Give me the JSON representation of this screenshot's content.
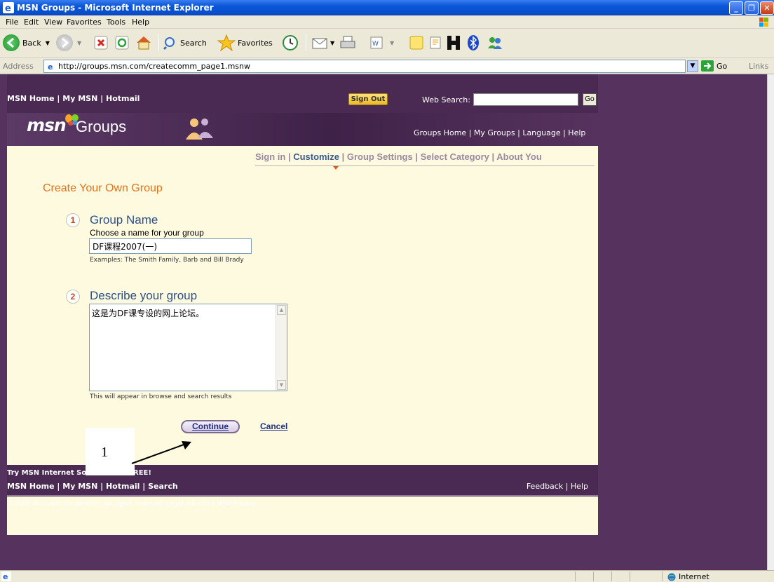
{
  "window": {
    "title": "MSN Groups - Microsoft Internet Explorer"
  },
  "menu": [
    "File",
    "Edit",
    "View",
    "Favorites",
    "Tools",
    "Help"
  ],
  "toolbar": {
    "back": "Back",
    "search": "Search",
    "favorites": "Favorites"
  },
  "address": {
    "label": "Address",
    "url": "http://groups.msn.com/createcomm_page1.msnw",
    "go": "Go",
    "links": "Links"
  },
  "msn_top": {
    "home": "MSN Home",
    "sep1": " | ",
    "mymsn": "My MSN",
    "sep2": " | ",
    "hotmail": "Hotmail",
    "signout": "Sign Out",
    "web_search_label": "Web Search:",
    "go": "Go"
  },
  "groups_band": {
    "logo": "msn",
    "word": "Groups",
    "nav": "Groups Home  |  My Groups  |  Language  |  Help"
  },
  "steps": {
    "signin": "Sign in",
    "customize": "Customize",
    "group_settings": "Group Settings",
    "select_category": "Select Category",
    "about_you": "About You",
    "sep": " | "
  },
  "form": {
    "title": "Create Your Own Group",
    "step1_num": "1",
    "step1_head": "Group Name",
    "step1_label": "Choose a name for your group",
    "group_name_value": "DF课程2007(一)",
    "step1_examples": "Examples: The Smith Family, Barb and Bill Brady",
    "step2_num": "2",
    "step2_head": "Describe your group",
    "description_value": "这是为DF课专设的网上论坛。",
    "step2_note": "This will appear in browse and search results",
    "continue": "Continue",
    "cancel": "Cancel"
  },
  "annotation": {
    "label": "1"
  },
  "footer": {
    "try": "Try MSN Internet Software for FREE!",
    "links": "MSN Home  |  My MSN  |  Hotmail  |  Search",
    "right": "Feedback  |  Help",
    "copyright": "©2005 Microsoft Corporation. All rights reserved.  Legal  Advertise  MSN Privacy"
  },
  "status": {
    "zone": "Internet"
  }
}
